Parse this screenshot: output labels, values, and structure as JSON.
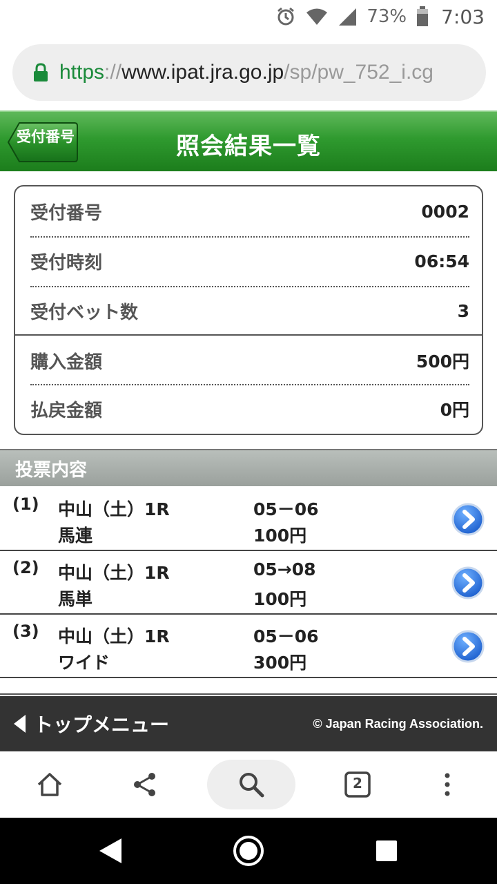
{
  "status_bar": {
    "battery": "73%",
    "time": "7:03",
    "icons": [
      "alarm-icon",
      "wifi-icon",
      "signal-icon",
      "battery-icon"
    ]
  },
  "url_bar": {
    "scheme": "https",
    "separator": "://",
    "host": "www.ipat.jra.go.jp",
    "path": "/sp/pw_752_i.cg"
  },
  "header": {
    "back_label": "受付番号",
    "title": "照会結果一覧",
    "accent_color": "#2f9a2f"
  },
  "info": [
    {
      "label": "受付番号",
      "value": "0002"
    },
    {
      "label": "受付時刻",
      "value": "06:54"
    },
    {
      "label": "受付ベット数",
      "value": "3"
    },
    {
      "label": "購入金額",
      "value": "500円"
    },
    {
      "label": "払戻金額",
      "value": "0円"
    }
  ],
  "votes": {
    "heading": "投票内容",
    "items": [
      {
        "num": "(1)",
        "race": "中山（土）1R",
        "type": "馬連",
        "combo": "05－06",
        "amount": "100円"
      },
      {
        "num": "(2)",
        "race": "中山（土）1R",
        "type": "馬単",
        "combo": "05→08",
        "amount": "100円"
      },
      {
        "num": "(3)",
        "race": "中山（土）1R",
        "type": "ワイド",
        "combo": "05－06",
        "amount": "300円"
      }
    ]
  },
  "footer": {
    "top_menu": "トップメニュー",
    "copyright": "© Japan Racing Association."
  },
  "toolbar": {
    "tab_count": "2",
    "icons": [
      "home-icon",
      "share-icon",
      "search-icon",
      "tabs-icon",
      "more-icon"
    ]
  },
  "navbar": {
    "icons": [
      "back-icon",
      "home-circle-icon",
      "recents-icon"
    ]
  }
}
